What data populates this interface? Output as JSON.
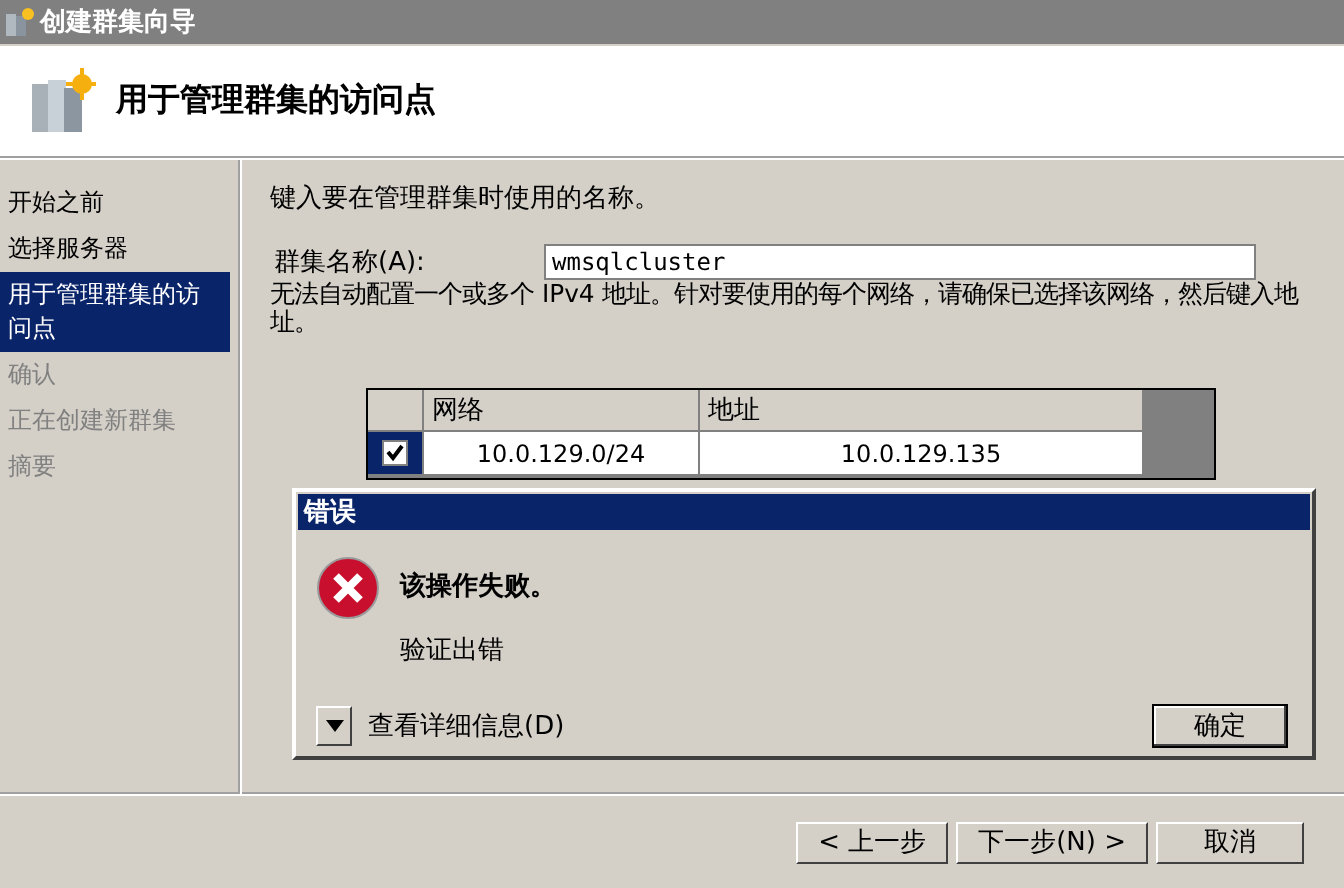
{
  "window": {
    "title": "创建群集向导"
  },
  "header": {
    "title": "用于管理群集的访问点"
  },
  "nav": {
    "items": [
      {
        "label": "开始之前",
        "selected": false,
        "disabled": false
      },
      {
        "label": "选择服务器",
        "selected": false,
        "disabled": false
      },
      {
        "label": "用于管理群集的访问点",
        "selected": true,
        "disabled": false
      },
      {
        "label": "确认",
        "selected": false,
        "disabled": true
      },
      {
        "label": "正在创建新群集",
        "selected": false,
        "disabled": true
      },
      {
        "label": "摘要",
        "selected": false,
        "disabled": true
      }
    ]
  },
  "content": {
    "instruction": "键入要在管理群集时使用的名称。",
    "name_field": {
      "label": "群集名称(A):",
      "value": "wmsqlcluster"
    },
    "note": "无法自动配置一个或多个 IPv4 地址。针对要使用的每个网络，请确保已选择该网络，然后键入地址。",
    "table": {
      "columns": [
        "网络",
        "地址"
      ],
      "rows": [
        {
          "selected": true,
          "checked": true,
          "network": "10.0.129.0/24",
          "address": "10.0.129.135"
        }
      ]
    }
  },
  "dialog": {
    "title": "错误",
    "message": "该操作失败。",
    "detail": "验证出错",
    "details_toggle": {
      "label": "查看详细信息(D)",
      "expanded": false
    },
    "buttons": [
      "确定"
    ]
  },
  "buttons": [
    "< 上一步",
    "下一步(N) >",
    "取消"
  ]
}
